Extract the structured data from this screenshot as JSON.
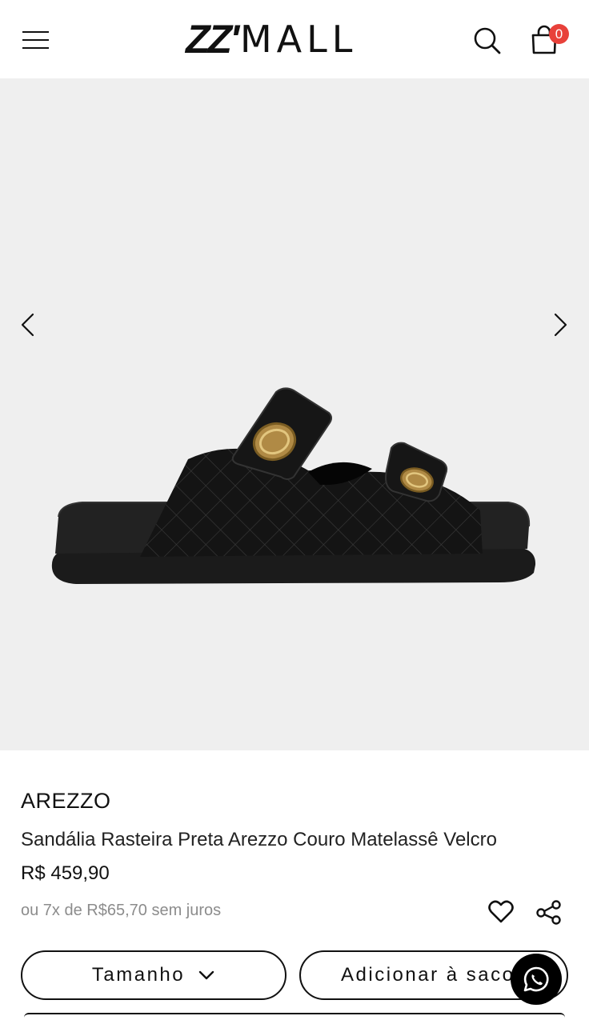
{
  "header": {
    "menu_icon": "hamburger-menu-icon",
    "logo_bold": "ZZ'",
    "logo_light": "MALL",
    "search_icon": "search-icon",
    "bag_icon": "shopping-bag-icon",
    "cart_count": "0"
  },
  "gallery": {
    "prev_icon": "chevron-left-icon",
    "next_icon": "chevron-right-icon",
    "background": "#efefef"
  },
  "product": {
    "brand": "AREZZO",
    "name": "Sandália Rasteira Preta Arezzo Couro Matelassê Velcro",
    "price": "R$ 459,90",
    "installments": "ou 7x de R$65,70 sem juros",
    "favorite_icon": "heart-icon",
    "share_icon": "share-icon"
  },
  "actions": {
    "size_label": "Tamanho",
    "size_icon": "chevron-down-icon",
    "add_label": "Adicionar à sacola",
    "whatsapp_icon": "whatsapp-icon"
  },
  "colors": {
    "badge": "#e8413a",
    "text": "#111111",
    "muted": "#8c8c8c"
  }
}
